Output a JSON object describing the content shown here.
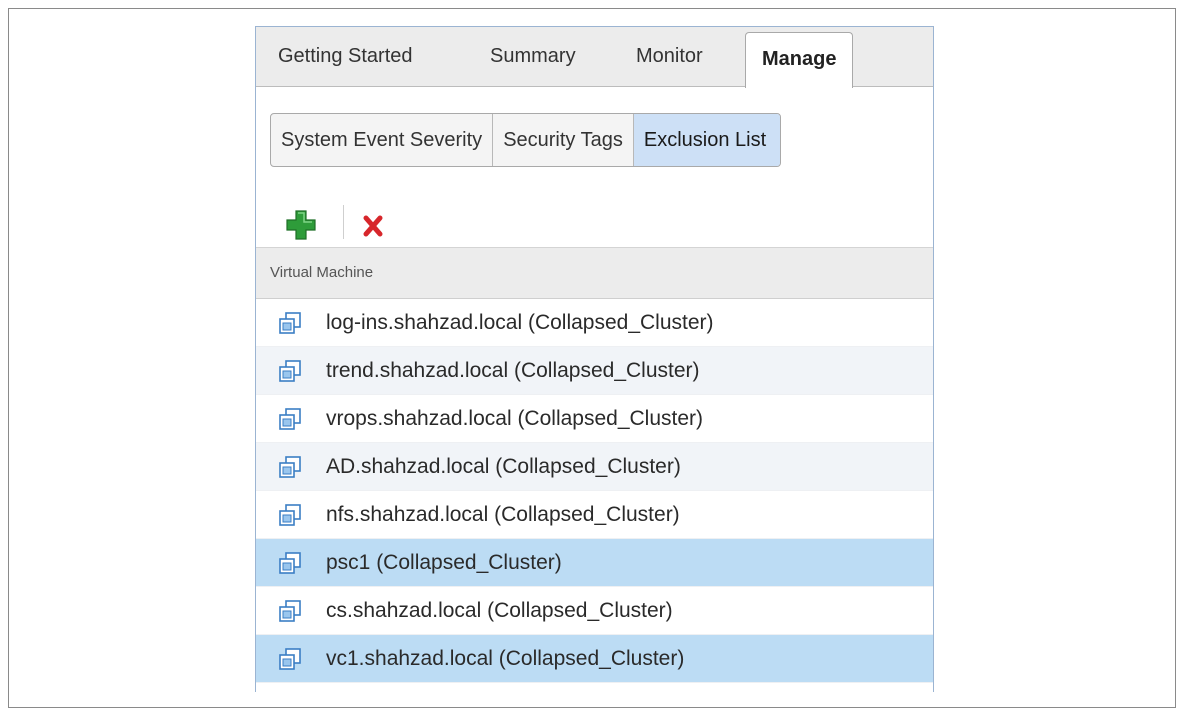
{
  "tabs": [
    {
      "label": "Getting Started"
    },
    {
      "label": "Summary"
    },
    {
      "label": "Monitor"
    },
    {
      "label": "Manage"
    }
  ],
  "subtabs": [
    {
      "label": "System Event Severity"
    },
    {
      "label": "Security Tags"
    },
    {
      "label": "Exclusion List"
    }
  ],
  "toolbar": {
    "add_icon": "add-icon",
    "remove_icon": "remove-icon"
  },
  "grid": {
    "column_header": "Virtual Machine",
    "rows": [
      {
        "label": "log-ins.shahzad.local (Collapsed_Cluster)",
        "selected": false
      },
      {
        "label": "trend.shahzad.local (Collapsed_Cluster)",
        "selected": false
      },
      {
        "label": "vrops.shahzad.local (Collapsed_Cluster)",
        "selected": false
      },
      {
        "label": "AD.shahzad.local (Collapsed_Cluster)",
        "selected": false
      },
      {
        "label": "nfs.shahzad.local (Collapsed_Cluster)",
        "selected": false
      },
      {
        "label": "psc1 (Collapsed_Cluster)",
        "selected": true
      },
      {
        "label": "cs.shahzad.local (Collapsed_Cluster)",
        "selected": false
      },
      {
        "label": "vc1.shahzad.local (Collapsed_Cluster)",
        "selected": true
      }
    ]
  },
  "colors": {
    "selected_row": "#bcdcf4",
    "active_subtab": "#cde0f6",
    "add_green": "#2e9c3a",
    "remove_red": "#d7262b"
  }
}
